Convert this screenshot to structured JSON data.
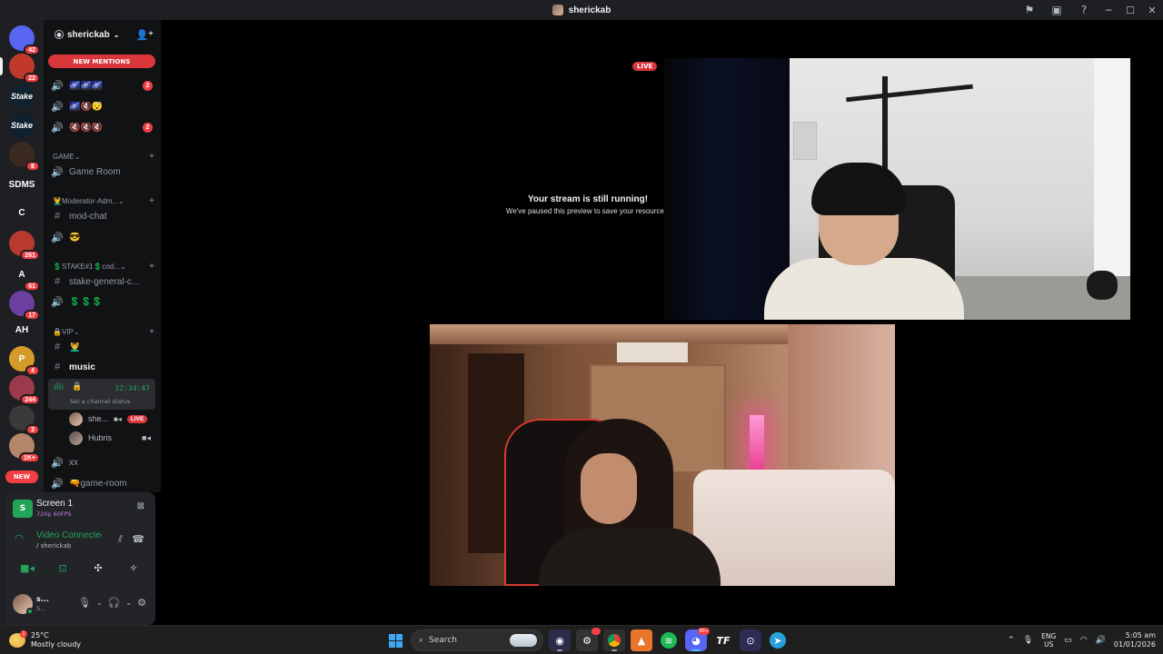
{
  "window": {
    "title": "sherickab"
  },
  "rail": {
    "servers": [
      {
        "label": "",
        "badge": "42",
        "color": "#5865f2",
        "icon": "discord-icon"
      },
      {
        "label": "",
        "badge": "22",
        "color": "#c0392b",
        "icon": "server-avatar-1"
      },
      {
        "label": "Stake",
        "badge": "",
        "color": "#0f212e",
        "icon": "stake-logo"
      },
      {
        "label": "Stake",
        "badge": "",
        "color": "#0f212e",
        "icon": "stake-logo"
      },
      {
        "label": "",
        "badge": "8",
        "color": "#3b2a1f",
        "icon": "server-avatar-2"
      },
      {
        "label": "SDMS",
        "badge": "",
        "color": "#1e1f22",
        "icon": ""
      },
      {
        "label": "C",
        "badge": "",
        "color": "#1e1f22",
        "icon": ""
      },
      {
        "label": "",
        "badge": "261",
        "color": "#b83a2e",
        "icon": "server-avatar-3"
      },
      {
        "label": "A",
        "badge": "61",
        "color": "#1e1f22",
        "icon": "a-logo"
      },
      {
        "label": "",
        "badge": "17",
        "color": "#6b3fa0",
        "icon": "server-avatar-4"
      },
      {
        "label": "AH",
        "badge": "",
        "color": "#1e1f22",
        "icon": ""
      },
      {
        "label": "P",
        "badge": "4",
        "color": "#d49b2a",
        "icon": "server-avatar-5"
      },
      {
        "label": "",
        "badge": "244",
        "color": "#9a3a4a",
        "icon": "server-avatar-6"
      },
      {
        "label": "",
        "badge": "3",
        "color": "#3a3a3a",
        "icon": "server-avatar-7"
      },
      {
        "label": "",
        "badge": "1K+",
        "color": "#b5866a",
        "icon": "server-avatar-8"
      }
    ],
    "new_label": "NEW"
  },
  "guild": {
    "name": "sherickab",
    "new_mentions": "NEW MENTIONS"
  },
  "channels": [
    {
      "kind": "voice",
      "name": "🌌🌌🌌",
      "badge": "2"
    },
    {
      "kind": "voice",
      "name": "🌌🔇😴",
      "badge": ""
    },
    {
      "kind": "voice",
      "name": "🔇🔇🔇",
      "badge": "2"
    },
    {
      "kind": "category",
      "name": "GAME"
    },
    {
      "kind": "voice",
      "name": "Game Room",
      "badge": ""
    },
    {
      "kind": "category",
      "name": "💆‍♂️Moderator-Adm..."
    },
    {
      "kind": "text",
      "name": "mod-chat",
      "badge": ""
    },
    {
      "kind": "voice",
      "name": "😎",
      "badge": ""
    },
    {
      "kind": "category",
      "name": "💲STAKE#1💲cod..."
    },
    {
      "kind": "text",
      "name": "stake-general-c...",
      "badge": ""
    },
    {
      "kind": "voice",
      "name": "💲💲💲",
      "badge": ""
    },
    {
      "kind": "category",
      "name": "🔒VIP"
    },
    {
      "kind": "text",
      "name": "💆‍♂️",
      "badge": ""
    },
    {
      "kind": "text",
      "name": "music",
      "badge": ""
    }
  ],
  "active_voice": {
    "timer": "12:34:47",
    "status": "Set a channel status",
    "users": [
      {
        "name": "she...",
        "live": "LIVE"
      },
      {
        "name": "Hubris",
        "live": ""
      }
    ]
  },
  "more_channels": [
    {
      "kind": "voice",
      "name": "xx"
    },
    {
      "kind": "voice",
      "name": "🔫game-room"
    }
  ],
  "panel": {
    "screen_title": "Screen 1",
    "screen_sub": "720p 60FPS",
    "vc_title": "Video Connected",
    "vc_sub": "/ sherickab",
    "user_name": "s...",
    "user_sub": "S..."
  },
  "stage": {
    "paused_title": "Your stream is still running!",
    "paused_sub": "We've paused this preview to save your resources.",
    "live_label": "LIVE"
  },
  "taskbar": {
    "temp": "25°C",
    "weather": "Mostly cloudy",
    "search_placeholder": "Search",
    "lang_top": "ENG",
    "lang_bottom": "US",
    "time": "5:05 am",
    "date": "01/01/2026",
    "discord_badge": "99+"
  },
  "colors": {
    "accent_red": "#da373c",
    "online_green": "#23a55a"
  }
}
